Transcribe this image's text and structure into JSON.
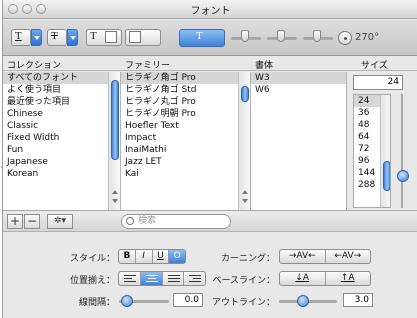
{
  "window": {
    "title": "フォント"
  },
  "toolbar": {
    "underline_glyph": "T",
    "strike_glyph": "T",
    "text_color_glyph": "T",
    "shadow_glyph": "T",
    "angle": "270°"
  },
  "columns": {
    "collection_header": "コレクション",
    "family_header": "ファミリー",
    "typeface_header": "書体",
    "size_header": "サイズ"
  },
  "collections": [
    "すべてのフォント",
    "よく使う項目",
    "最近使った項目",
    "Chinese",
    "Classic",
    "Fixed Width",
    "Fun",
    "Japanese",
    "Korean"
  ],
  "families": [
    "ヒラギノ角ゴ Pro",
    "ヒラギノ角ゴ Std",
    "ヒラギノ丸ゴ Pro",
    "ヒラギノ明朝 Pro",
    "Hoefler Text",
    "Impact",
    "InaiMathi",
    "Jazz LET",
    "Kai"
  ],
  "typefaces": [
    "W3",
    "W6"
  ],
  "size": {
    "value": "24",
    "options": [
      "24",
      "36",
      "48",
      "64",
      "72",
      "96",
      "144",
      "288"
    ]
  },
  "bottom": {
    "add": "+",
    "remove": "−",
    "gear": "✲▾",
    "search_placeholder": "検索"
  },
  "style_row": {
    "style_label": "スタイル：",
    "bold": "B",
    "italic": "I",
    "underline": "U",
    "outline": "O",
    "kerning_label": "カーニング：",
    "kern_tighter": "→AV←",
    "kern_looser": "←AV→"
  },
  "align_row": {
    "align_label": "位置揃え：",
    "baseline_label": "ベースライン：",
    "baseline_down": "↓A",
    "baseline_up": "↑A"
  },
  "spacing_row": {
    "spacing_label": "線間隔：",
    "spacing_value": "0.0",
    "outline_label": "アウトライン：",
    "outline_value": "3.0"
  }
}
